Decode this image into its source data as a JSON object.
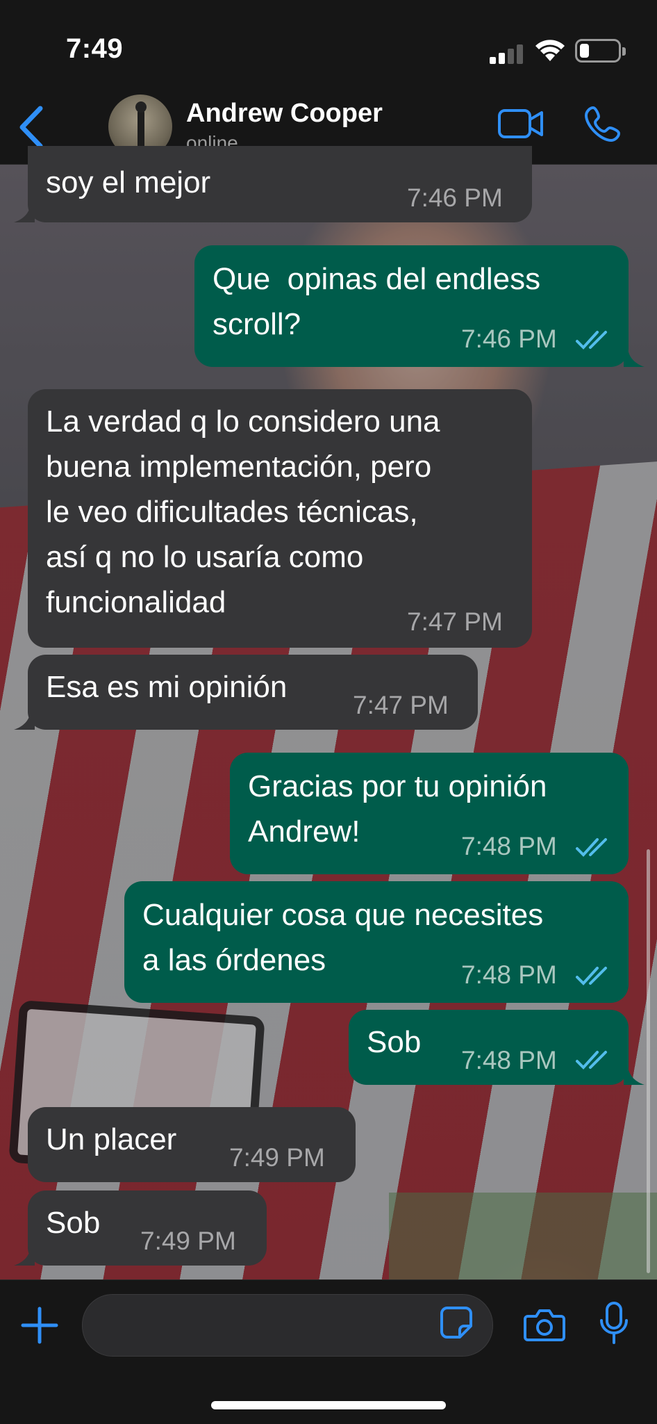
{
  "status_bar": {
    "time": "7:49"
  },
  "header": {
    "contact_name": "Andrew Cooper",
    "contact_status": "online",
    "accent_color": "#2f8ff7",
    "icons": [
      "back-chevron-icon",
      "video-call-icon",
      "phone-icon"
    ]
  },
  "messages": [
    {
      "direction": "in",
      "text": "soy el mejor",
      "time": "7:46 PM"
    },
    {
      "direction": "out",
      "text": "Que  opinas del endless\nscroll?",
      "time": "7:46 PM",
      "read": true
    },
    {
      "direction": "in",
      "text": "La verdad q lo considero una\nbuena implementación, pero\nle veo dificultades técnicas,\nasí q no lo usaría como\nfuncionalidad",
      "time": "7:47 PM"
    },
    {
      "direction": "in",
      "text": "Esa es mi opinión",
      "time": "7:47 PM"
    },
    {
      "direction": "out",
      "text": "Gracias por tu opinión\nAndrew!",
      "time": "7:48 PM",
      "read": true
    },
    {
      "direction": "out",
      "text": "Cualquier cosa que necesites\na las órdenes",
      "time": "7:48 PM",
      "read": true
    },
    {
      "direction": "out",
      "text": "Sob",
      "time": "7:48 PM",
      "read": true
    },
    {
      "direction": "in",
      "text": "Un placer",
      "time": "7:49 PM"
    },
    {
      "direction": "in",
      "text": "Sob",
      "time": "7:49 PM"
    }
  ],
  "composer": {
    "icons": [
      "plus-icon",
      "sticker-icon",
      "camera-icon",
      "microphone-icon"
    ]
  },
  "colors": {
    "incoming_bubble": "#363638",
    "outgoing_bubble": "#005c4b",
    "read_ticks": "#53bdeb"
  }
}
